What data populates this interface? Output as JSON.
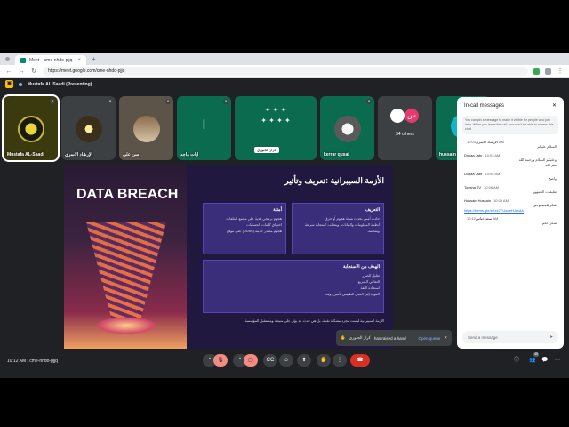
{
  "browser": {
    "tab_title": "Meet – cme-nhdo-pjjq",
    "url": "https://meet.google.com/cme-nhdo-pjjq"
  },
  "meet": {
    "presenter_label": "Mustafa AL-Saadi (Presenting)",
    "meeting_code": "cme-nhdo-pjjq",
    "time": "10:12 AM"
  },
  "participants": [
    {
      "name": "Mustafa AL-Saadi"
    },
    {
      "name": "الإرشاد الاسري"
    },
    {
      "name": "سن على"
    },
    {
      "name": "ايات ماجد",
      "initial": "ا"
    },
    {
      "name": "كرار الجبوري"
    },
    {
      "name": "kerrar qusai"
    },
    {
      "name": "34 others",
      "avatar_letter": "س"
    },
    {
      "name": "hussain ayaya",
      "initial": "h"
    }
  ],
  "slide": {
    "left_title": "DATA BREACH",
    "title": "الأزمة السيبرانية :تعريف وتأثير",
    "box1_heading": "أمثلة",
    "box1_lines": [
      "هجوم برمجي فدية على مجمع الملفات",
      "اختراق كلمات الحسابات",
      "هجوم مصدر خدمة (DDoS) على موقع"
    ],
    "box2_heading": "التعريف",
    "box2_lines": [
      "حادث أمني يحدث نتيجة هجوم أو خرق",
      "أنظمة المعلومات والبيانات، ويتطلب استجابة سريعة",
      "ومنظمة."
    ],
    "box3_heading": "الهدف من الاستجابة",
    "box3_lines": [
      "تقليل الضرر",
      "التعافي السريع",
      "استعادة الثقة",
      "العودة إلى العمل الطبيعي بأسرع وقت"
    ],
    "footer": "الأزمة السيبرانية ليست مجرد مشكلة تقنية، بل هي حدث قد يؤثر على سمعة ومستقبل المؤسسة"
  },
  "chat": {
    "title": "In-call messages",
    "note": "You can pin a message to make it visible for people who join later. When you leave the call, you won't be able to access this chat.",
    "messages": [
      {
        "who": "الإرشاد الاسري",
        "time": "10:03 AM",
        "text": "السلام عليكم"
      },
      {
        "who": "Doyaa Jabr",
        "time": "10:03 AM",
        "text": "وعليكم السلام ورحمة الله"
      },
      {
        "who": "",
        "time": "",
        "text": "نعم الله"
      },
      {
        "who": "Doyaa Jabr",
        "time": "10:05 AM",
        "text": "واضح"
      },
      {
        "who": "Toosha TV",
        "time": "10:06 AM",
        "text": "تعليقات الجمهور"
      },
      {
        "who": "Hussain Hussain",
        "time": "10:08 AM",
        "text": "شكر للمتطوعين"
      },
      {
        "who": "",
        "time": "",
        "text": "https://forms.gle/eXez7FUadeHJasdA"
      },
      {
        "who": "سعد عباس",
        "time": "10:12 AM",
        "text": "شكراً لكم"
      }
    ],
    "send_placeholder": "Send a message"
  },
  "toast": {
    "name": "كرار الجبوري",
    "text": "has raised a hand",
    "action": "Open queue"
  },
  "controls": {
    "people_count": "45"
  }
}
